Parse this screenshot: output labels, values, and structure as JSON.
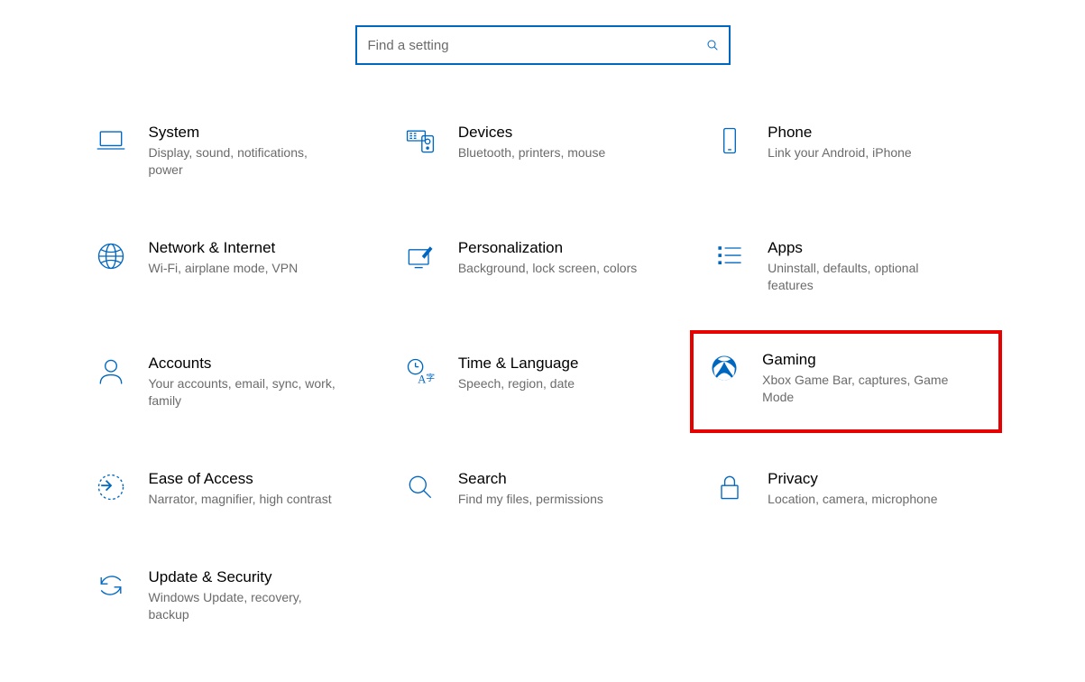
{
  "search": {
    "placeholder": "Find a setting",
    "value": ""
  },
  "highlighted": "gaming",
  "categories": [
    {
      "id": "system",
      "title": "System",
      "subtitle": "Display, sound, notifications, power"
    },
    {
      "id": "devices",
      "title": "Devices",
      "subtitle": "Bluetooth, printers, mouse"
    },
    {
      "id": "phone",
      "title": "Phone",
      "subtitle": "Link your Android, iPhone"
    },
    {
      "id": "network",
      "title": "Network & Internet",
      "subtitle": "Wi-Fi, airplane mode, VPN"
    },
    {
      "id": "personalization",
      "title": "Personalization",
      "subtitle": "Background, lock screen, colors"
    },
    {
      "id": "apps",
      "title": "Apps",
      "subtitle": "Uninstall, defaults, optional features"
    },
    {
      "id": "accounts",
      "title": "Accounts",
      "subtitle": "Your accounts, email, sync, work, family"
    },
    {
      "id": "time",
      "title": "Time & Language",
      "subtitle": "Speech, region, date"
    },
    {
      "id": "gaming",
      "title": "Gaming",
      "subtitle": "Xbox Game Bar, captures, Game Mode"
    },
    {
      "id": "ease",
      "title": "Ease of Access",
      "subtitle": "Narrator, magnifier, high contrast"
    },
    {
      "id": "search",
      "title": "Search",
      "subtitle": "Find my files, permissions"
    },
    {
      "id": "privacy",
      "title": "Privacy",
      "subtitle": "Location, camera, microphone"
    },
    {
      "id": "update",
      "title": "Update & Security",
      "subtitle": "Windows Update, recovery, backup"
    }
  ]
}
